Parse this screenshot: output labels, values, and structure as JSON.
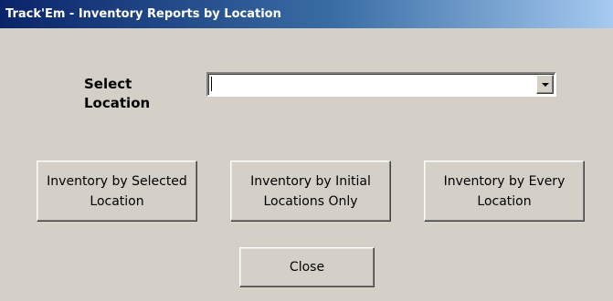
{
  "window": {
    "title": "Track'Em - Inventory Reports by Location"
  },
  "form": {
    "select_label": "Select Location",
    "location_combo": {
      "value": ""
    }
  },
  "buttons": {
    "selected_location": "Inventory by Selected Location",
    "initial_locations": "Inventory by Initial Locations Only",
    "every_location": "Inventory by Every Location",
    "close": "Close"
  },
  "colors": {
    "title_start": "#0a246a",
    "title_end": "#a6caf0",
    "face": "#d4d0c8"
  }
}
